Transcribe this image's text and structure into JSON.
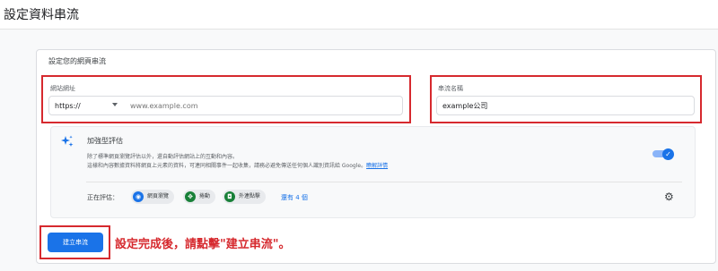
{
  "page": {
    "title": "設定資料串流"
  },
  "section": {
    "label": "設定您的網頁串流"
  },
  "website_url": {
    "label": "網站網址",
    "protocol": "https://",
    "placeholder": "www.example.com"
  },
  "stream_name": {
    "label": "串流名稱",
    "value": "example公司"
  },
  "enhanced_measurement": {
    "title": "加強型評估",
    "description_line1": "除了標準網頁瀏覽評估以外，還自動評估網站上的互動和內容。",
    "description_line2": "這樣和內容數據資料將網頁上元素的資料，可連同相關事件一起收集，請務必避免傳送任何個人識別資訊給 Google。",
    "learn_more": "瞭解詳情",
    "enabled": true,
    "measuring_label": "正在評估：",
    "chips": [
      {
        "label": "網頁瀏覽",
        "icon": "eye-icon",
        "color": "#1a73e8"
      },
      {
        "label": "捲動",
        "icon": "scroll-icon",
        "color": "#188038"
      },
      {
        "label": "外連點擊",
        "icon": "lock-icon",
        "color": "#188038"
      }
    ],
    "more_link": "還有 4 個"
  },
  "actions": {
    "create_label": "建立串流"
  },
  "annotation": {
    "text": "設定完成後，請點擊\"建立串流\"。"
  },
  "colors": {
    "accent": "#1a73e8",
    "highlight": "#d6292e"
  }
}
